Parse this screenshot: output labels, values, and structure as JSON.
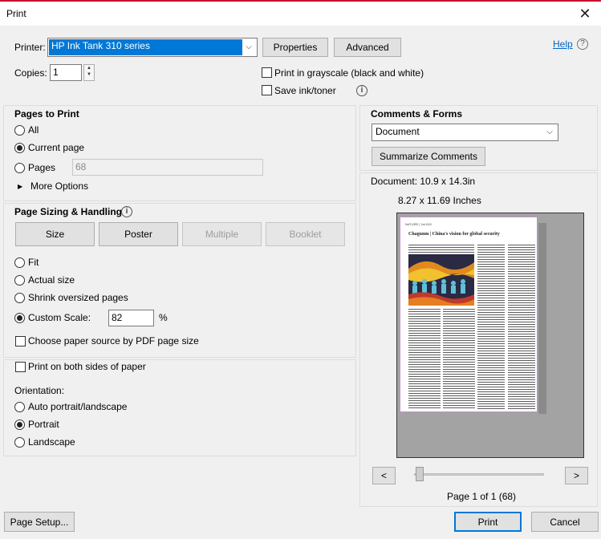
{
  "window": {
    "title": "Print"
  },
  "printer": {
    "label": "Printer:",
    "selected": "HP Ink Tank 310 series",
    "properties_label": "Properties",
    "advanced_label": "Advanced",
    "help_label": "Help",
    "copies_label": "Copies:",
    "copies_value": "1",
    "grayscale_label": "Print in grayscale (black and white)",
    "save_ink_label": "Save ink/toner"
  },
  "pages_to_print": {
    "title": "Pages to Print",
    "all_label": "All",
    "current_page_label": "Current page",
    "pages_label": "Pages",
    "pages_value": "68",
    "more_options_label": "More Options",
    "selected": "Current page"
  },
  "sizing": {
    "title": "Page Sizing & Handling",
    "tabs": [
      {
        "label": "Size",
        "enabled": true
      },
      {
        "label": "Poster",
        "enabled": true
      },
      {
        "label": "Multiple",
        "enabled": false
      },
      {
        "label": "Booklet",
        "enabled": false
      }
    ],
    "fit_label": "Fit",
    "actual_size_label": "Actual size",
    "shrink_label": "Shrink oversized pages",
    "custom_scale_label": "Custom Scale:",
    "custom_scale_value": "82",
    "percent_sign": "%",
    "paper_source_label": "Choose paper source by PDF page size",
    "selected": "Custom Scale:"
  },
  "duplex": {
    "both_sides_label": "Print on both sides of paper",
    "orientation_label": "Orientation:",
    "auto_label": "Auto portrait/landscape",
    "portrait_label": "Portrait",
    "landscape_label": "Landscape",
    "selected": "Portrait"
  },
  "comments": {
    "title": "Comments & Forms",
    "selected": "Document",
    "summarize_label": "Summarize Comments"
  },
  "preview": {
    "document_size": "Document: 10.9 x 14.3in",
    "paper_size": "8.27 x 11.69 Inches",
    "article_header": "NATURE | Vol 615",
    "article_title": "Chagunm | China's vision for global security",
    "prev_label": "<",
    "next_label": ">",
    "page_info": "Page 1 of 1 (68)",
    "page_fraction": 0.0
  },
  "footer": {
    "page_setup_label": "Page Setup...",
    "print_label": "Print",
    "cancel_label": "Cancel"
  },
  "colors": {
    "accent": "#0078d7",
    "title_stripe": "#c8102e",
    "link": "#0066cc"
  }
}
